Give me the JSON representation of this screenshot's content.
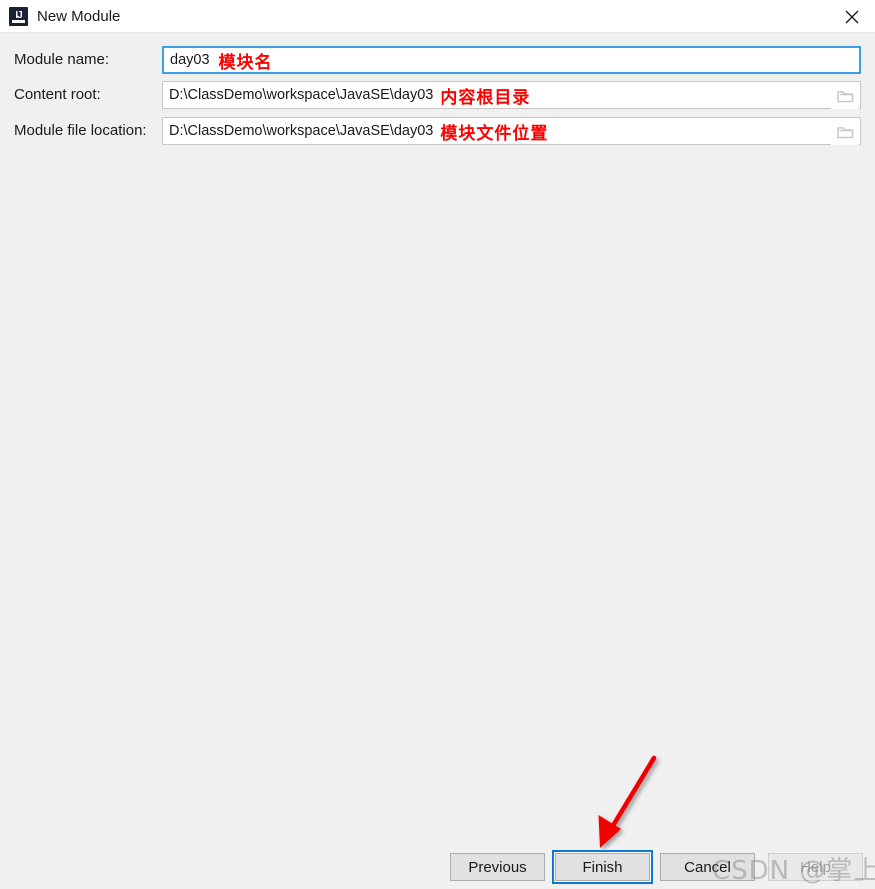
{
  "window": {
    "title": "New Module",
    "app_icon": "intellij-idea-icon",
    "close_icon": "close-icon",
    "titlebar_bg": "#ffffff",
    "body_bg": "#f0f0f0"
  },
  "form": {
    "rows": [
      {
        "label": "Module name:",
        "value": "day03",
        "annotation": "模块名",
        "focused": true,
        "has_browse": false,
        "browse_icon": ""
      },
      {
        "label": "Content root:",
        "value": "D:\\ClassDemo\\workspace\\JavaSE\\day03",
        "annotation": "内容根目录",
        "focused": false,
        "has_browse": true,
        "browse_icon": "folder-icon"
      },
      {
        "label": "Module file location:",
        "value": "D:\\ClassDemo\\workspace\\JavaSE\\day03",
        "annotation": "模块文件位置",
        "focused": false,
        "has_browse": true,
        "browse_icon": "folder-icon"
      }
    ]
  },
  "buttons": {
    "previous": "Previous",
    "finish": "Finish",
    "cancel": "Cancel",
    "help": "Help"
  },
  "annotations": {
    "color": "#ff0000",
    "arrow": "red-arrow-pointing-to-finish"
  },
  "watermark": {
    "text": "CSDN @掌上空."
  }
}
